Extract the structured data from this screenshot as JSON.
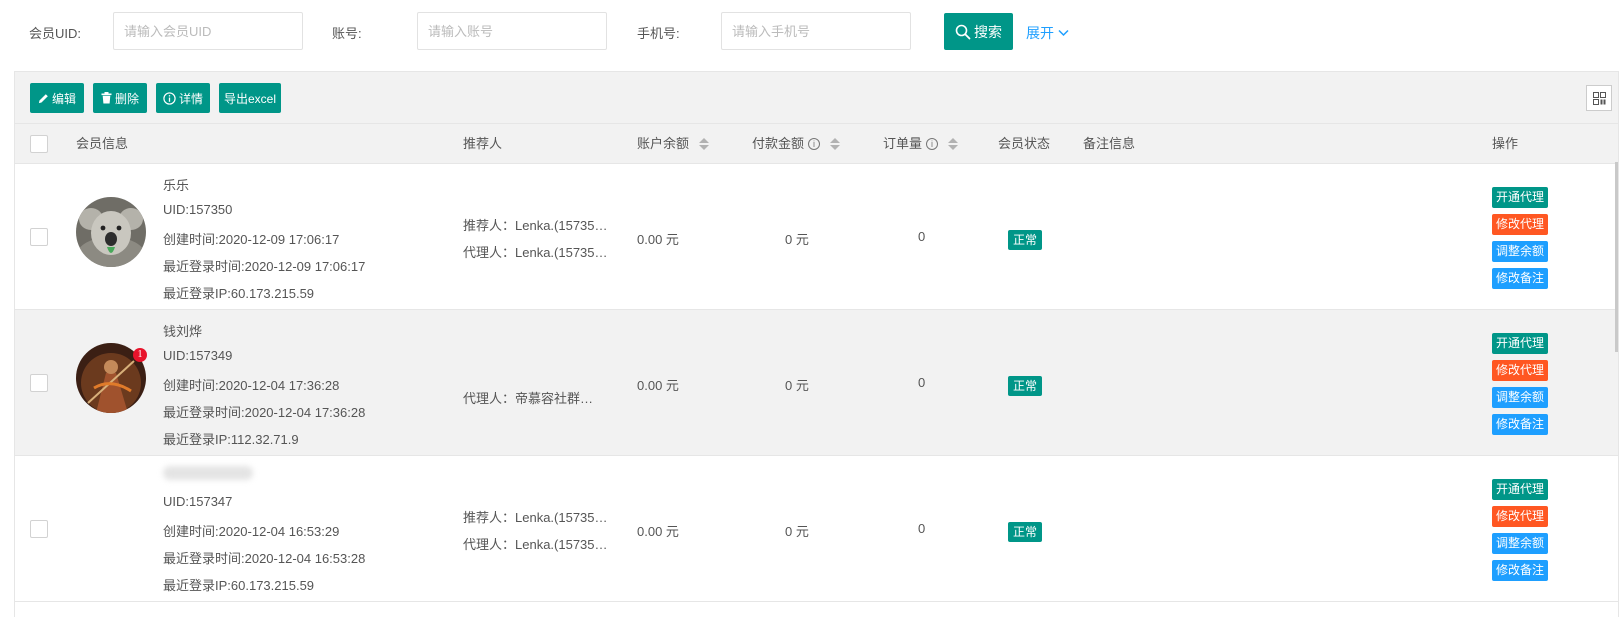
{
  "search": {
    "uid_label": "会员UID:",
    "uid_placeholder": "请输入会员UID",
    "account_label": "账号:",
    "account_placeholder": "请输入账号",
    "phone_label": "手机号:",
    "phone_placeholder": "请输入手机号",
    "search_button": "搜索",
    "expand_link": "展开"
  },
  "toolbar": {
    "edit": "编辑",
    "delete": "删除",
    "detail": "详情",
    "export": "导出excel"
  },
  "columns": {
    "member_info": "会员信息",
    "referrer": "推荐人",
    "balance": "账户余额",
    "payment": "付款金额",
    "orders": "订单量",
    "status": "会员状态",
    "remark": "备注信息",
    "actions": "操作"
  },
  "rows": [
    {
      "name": "乐乐",
      "uid": "UID:157350",
      "created": "创建时间:2020-12-09 17:06:17",
      "last_login": "最近登录时间:2020-12-09 17:06:17",
      "last_ip": "最近登录IP:60.173.215.59",
      "referrer": "推荐人：Lenka.(15735…",
      "agent": "代理人：Lenka.(15735…",
      "balance": "0.00 元",
      "payment": "0 元",
      "orders": "0",
      "status": "正常"
    },
    {
      "name": "钱刘烨",
      "uid": "UID:157349",
      "created": "创建时间:2020-12-04 17:36:28",
      "last_login": "最近登录时间:2020-12-04 17:36:28",
      "last_ip": "最近登录IP:112.32.71.9",
      "referrer": "",
      "agent": "代理人：帝慕容社群…",
      "balance": "0.00 元",
      "payment": "0 元",
      "orders": "0",
      "status": "正常",
      "avatar_badge": "1"
    },
    {
      "name": "",
      "uid": "UID:157347",
      "created": "创建时间:2020-12-04 16:53:29",
      "last_login": "最近登录时间:2020-12-04 16:53:28",
      "last_ip": "最近登录IP:60.173.215.59",
      "referrer": "推荐人：Lenka.(15735…",
      "agent": "代理人：Lenka.(15735…",
      "balance": "0.00 元",
      "payment": "0 元",
      "orders": "0",
      "status": "正常"
    }
  ],
  "row_actions": {
    "open_agent": "开通代理",
    "edit_agent": "修改代理",
    "adjust_balance": "调整余额",
    "edit_remark": "修改备注"
  },
  "colors": {
    "primary": "#009688",
    "danger": "#ff5722",
    "info": "#1e9fff",
    "link": "#1e9fff"
  }
}
